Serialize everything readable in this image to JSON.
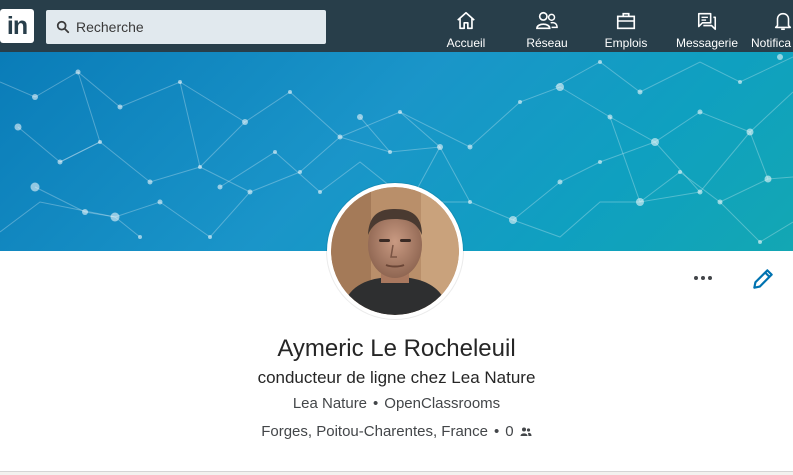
{
  "nav": {
    "logo": "in",
    "search_placeholder": "Recherche",
    "items": [
      {
        "label": "Accueil",
        "icon": "home-icon"
      },
      {
        "label": "Réseau",
        "icon": "people-icon"
      },
      {
        "label": "Emplois",
        "icon": "briefcase-icon"
      },
      {
        "label": "Messagerie",
        "icon": "messaging-icon"
      },
      {
        "label": "Notifica",
        "icon": "bell-icon"
      }
    ]
  },
  "profile": {
    "name": "Aymeric Le Rocheleuil",
    "headline": "conducteur de ligne chez Lea Nature",
    "company": "Lea Nature",
    "school": "OpenClassrooms",
    "separator": "•",
    "location": "Forges, Poitou-Charentes, France",
    "connections": "0"
  },
  "colors": {
    "nav_bg": "#283e4a",
    "accent": "#0073b1",
    "banner": "#0a8fc4"
  }
}
